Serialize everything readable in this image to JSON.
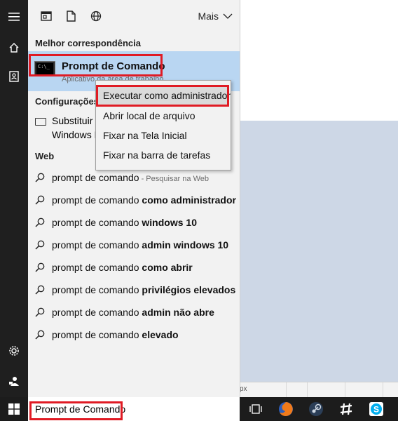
{
  "toolbar": {
    "more_label": "Mais"
  },
  "best_match": {
    "heading": "Melhor correspondência",
    "title": "Prompt de Comando",
    "subtitle": "Aplicativo da área de trabalho",
    "icon_text": "C:\\_"
  },
  "settings": {
    "heading": "Configurações",
    "item_line1": "Substituir",
    "item_line2": "Windows P"
  },
  "web": {
    "heading": "Web",
    "items": [
      {
        "base": "prompt de comando",
        "suffix": "",
        "hint": " - Pesquisar na Web"
      },
      {
        "base": "prompt de comando ",
        "suffix": "como administrador",
        "hint": ""
      },
      {
        "base": "prompt de comando ",
        "suffix": "windows 10",
        "hint": ""
      },
      {
        "base": "prompt de comando ",
        "suffix": "admin windows 10",
        "hint": ""
      },
      {
        "base": "prompt de comando ",
        "suffix": "como abrir",
        "hint": ""
      },
      {
        "base": "prompt de comando ",
        "suffix": "privilégios elevados",
        "hint": ""
      },
      {
        "base": "prompt de comando ",
        "suffix": "admin não abre",
        "hint": ""
      },
      {
        "base": "prompt de comando ",
        "suffix": "elevado",
        "hint": ""
      }
    ]
  },
  "context_menu": {
    "items": [
      "Executar como administrador",
      "Abrir local de arquivo",
      "Fixar na Tela Inicial",
      "Fixar na barra de tarefas"
    ]
  },
  "search": {
    "query": "Prompt de Comando"
  },
  "desktop": {
    "bottom_text": "px"
  },
  "colors": {
    "highlight": "#b9d6f2",
    "annotation": "#e01b24",
    "rail": "#1f1f1f"
  }
}
